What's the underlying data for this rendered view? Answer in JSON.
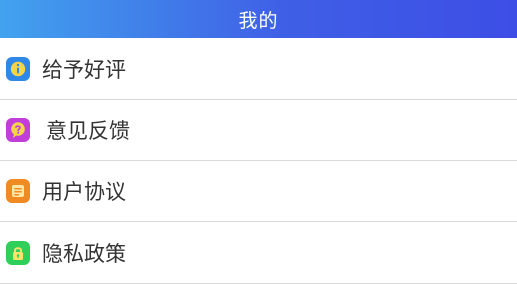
{
  "header": {
    "title": "我的"
  },
  "menu": {
    "items": [
      {
        "label": "给予好评",
        "icon": "info-rate-icon",
        "color": "#2f88e8",
        "accent": "#f4d54a"
      },
      {
        "label": "意见反馈",
        "icon": "question-feedback-icon",
        "color": "#c13fd8",
        "accent": "#f4d54a"
      },
      {
        "label": "用户协议",
        "icon": "document-icon",
        "color": "#f08a22",
        "accent": "#ffe7a8"
      },
      {
        "label": "隐私政策",
        "icon": "lock-icon",
        "color": "#2fcf5a",
        "accent": "#ffe36a"
      }
    ]
  }
}
